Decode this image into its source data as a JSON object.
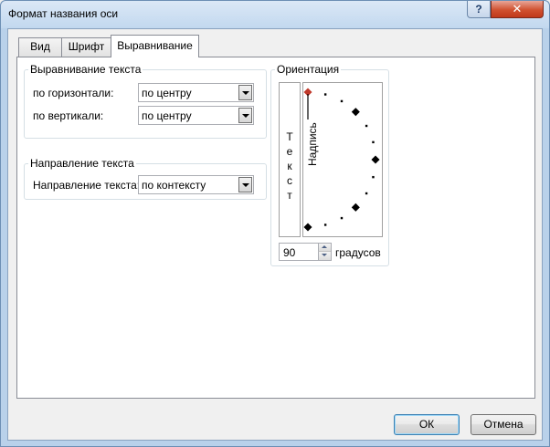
{
  "window": {
    "title": "Формат названия оси",
    "help_label": "?",
    "close_label": "✕"
  },
  "tabs": [
    {
      "label": "Вид",
      "active": false
    },
    {
      "label": "Шрифт",
      "active": false
    },
    {
      "label": "Выравнивание",
      "active": true
    }
  ],
  "text_alignment": {
    "group_title": "Выравнивание текста",
    "horizontal_label": "по горизонтали:",
    "horizontal_value": "по центру",
    "vertical_label": "по вертикали:",
    "vertical_value": "по центру"
  },
  "text_direction": {
    "group_title": "Направление текста",
    "label": "Направление текста:",
    "value": "по контексту"
  },
  "orientation": {
    "group_title": "Ориентация",
    "vertical_text_chars": [
      "Т",
      "е",
      "к",
      "с",
      "т"
    ],
    "rotated_label": "Надпись",
    "degrees_value": "90",
    "degrees_unit": "градусов",
    "marker_color": "#c0392b"
  },
  "buttons": {
    "ok": "ОК",
    "cancel": "Отмена"
  }
}
